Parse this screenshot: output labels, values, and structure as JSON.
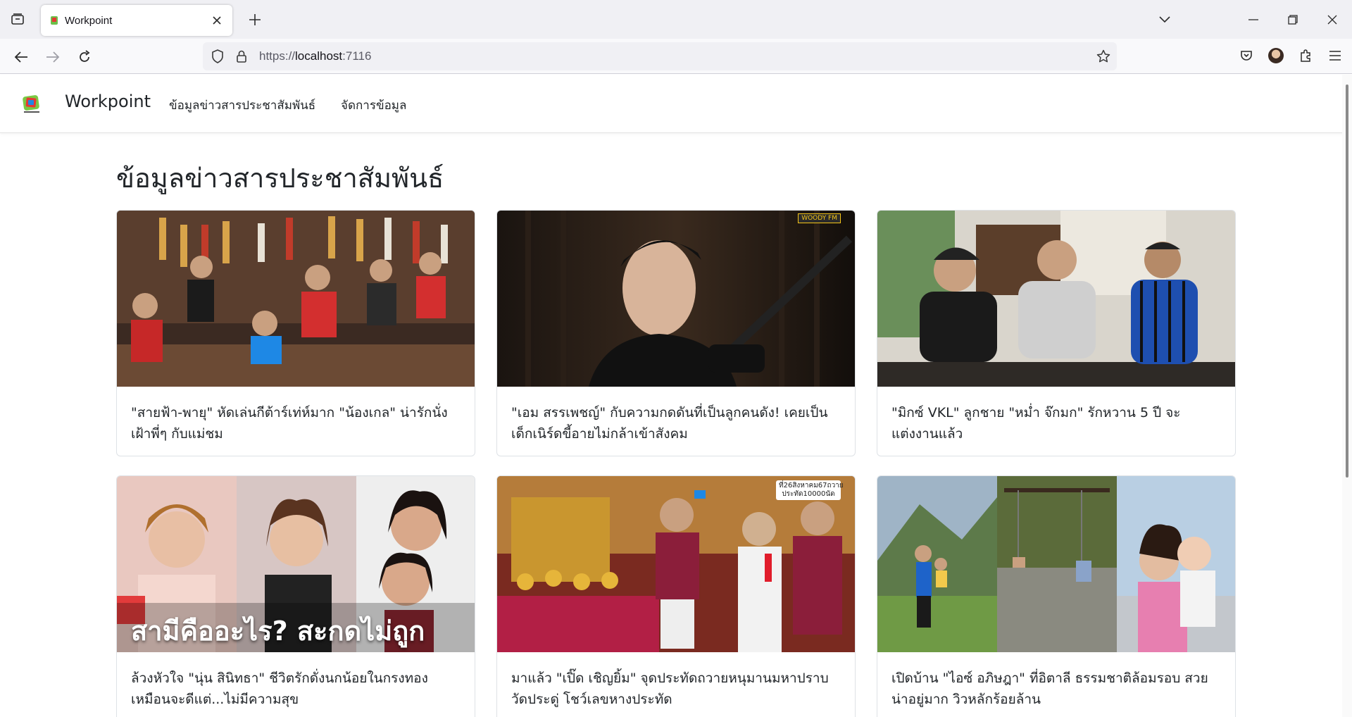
{
  "browser": {
    "tab_title": "Workpoint",
    "url_scheme": "https://",
    "url_host": "localhost",
    "url_port": ":7116"
  },
  "site": {
    "brand": "Workpoint",
    "nav": [
      "ข้อมูลข่าวสารประชาสัมพันธ์",
      "จัดการข้อมูล"
    ]
  },
  "page": {
    "title": "ข้อมูลข่าวสารประชาสัมพันธ์"
  },
  "cards": [
    {
      "title": "\"สายฟ้า-พายุ\" หัดเล่นกีต้าร์เท่ห์มาก \"น้องเกล\" น่ารักนั่งเฝ้าพี่ๆ กับแม่ชม"
    },
    {
      "title": "\"เอม สรรเพชญ์\" กับความกดดันที่เป็นลูกคนดัง! เคยเป็นเด็กเนิร์ดขี้อายไม่กล้าเข้าสังคม",
      "image_badge": "WOODY FM"
    },
    {
      "title": "\"มิกซ์ VKL\" ลูกชาย \"หม่ำ จ๊กมก\" รักหวาน 5 ปี จะแต่งงานแล้ว"
    },
    {
      "title": "ล้วงหัวใจ \"นุ่น สินิทธา\" ชีวิตรักดั่งนกน้อยในกรงทอง เหมือนจะดีแต่...ไม่มีความสุข",
      "image_overlay": "สามีคืออะไร? สะกดไม่ถูก"
    },
    {
      "title": "มาแล้ว \"เปิ๊ด เชิญยิ้ม\" จุดประทัดถวายหนุมานมหาปราบ วัดประดู่ โชว์เลขหางประทัด",
      "image_badge": "ที่26สิงหาคม67ถวาย ประทัด10000นัด"
    },
    {
      "title": "เปิดบ้าน \"ไอซ์ อภิษฎา\" ที่อิตาลี ธรรมชาติล้อมรอบ สวยน่าอยู่มาก วิวหลักร้อยล้าน"
    }
  ]
}
